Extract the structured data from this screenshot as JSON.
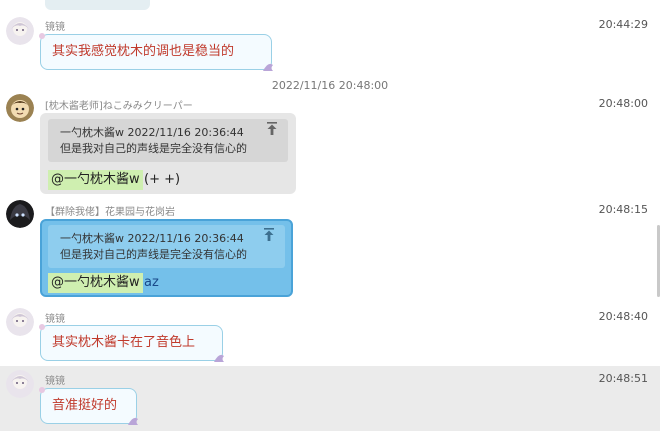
{
  "colors": {
    "bubble_text": "#c0392b",
    "bubble_border": "#9ad0e6",
    "selection_blue": "#74c0ea",
    "mention_green": "#cfefb0"
  },
  "messages": [
    {
      "sender": "镜镜",
      "time": "20:44:29",
      "text": "其实我感觉枕木的调也是稳当的"
    },
    {
      "sender": "[枕木酱老师]ねこみみクリーパー",
      "time": "20:48:00",
      "quote_line1": "一勺枕木酱w  2022/11/16 20:36:44",
      "quote_line2": "但是我对自己的声线是完全没有信心的",
      "mention": "@一勺枕木酱w",
      "reply_text": " (+ +)"
    },
    {
      "sender": "【群除我佬】花果园与花岗岩",
      "time": "20:48:15",
      "quote_line1": "一勺枕木酱w  2022/11/16 20:36:44",
      "quote_line2": "但是我对自己的声线是完全没有信心的",
      "mention": "@一勺枕木酱w",
      "reply_text": " az"
    },
    {
      "sender": "镜镜",
      "time": "20:48:40",
      "text": "其实枕木酱卡在了音色上"
    },
    {
      "sender": "镜镜",
      "time": "20:48:51",
      "text": "音准挺好的"
    }
  ],
  "separator": "2022/11/16 20:48:00"
}
